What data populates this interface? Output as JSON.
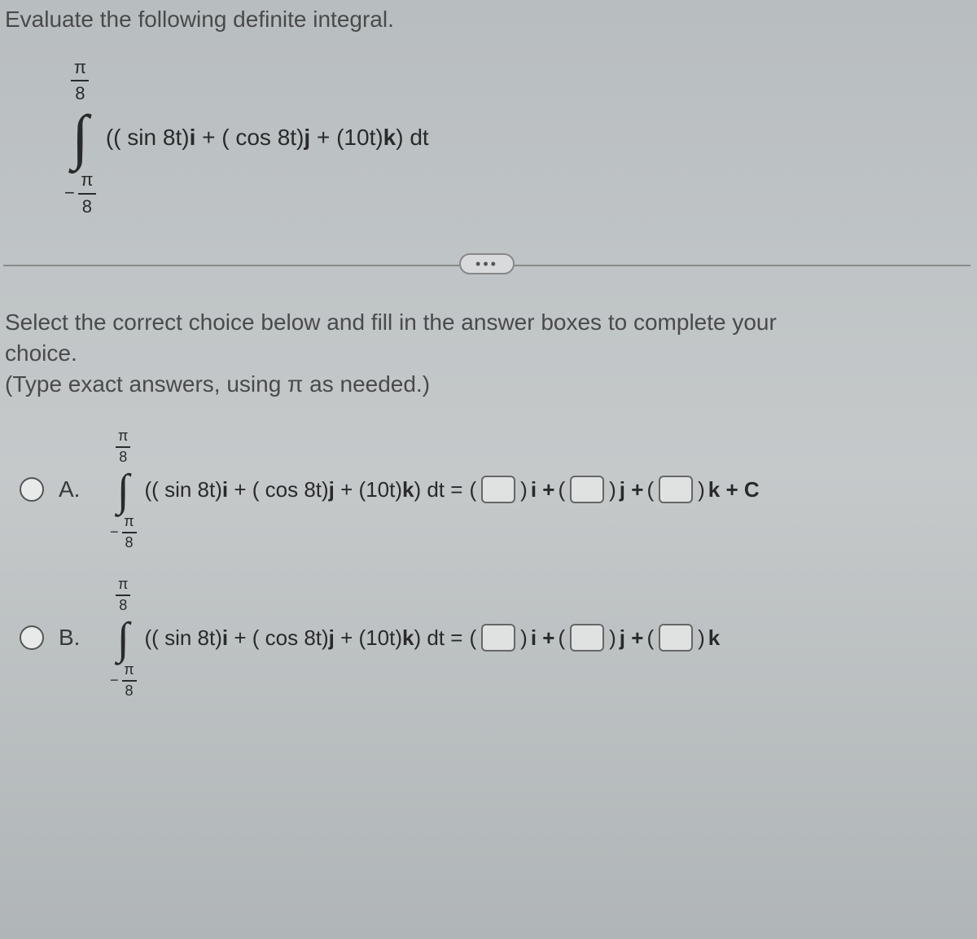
{
  "question": "Evaluate the following definite integral.",
  "integral": {
    "upper_num": "π",
    "upper_den": "8",
    "lower_minus": "−",
    "lower_num": "π",
    "lower_den": "8",
    "sym": "∫",
    "expr_open": "((",
    "sin": " sin ",
    "arg8t": "8t)",
    "i": "i",
    "plus1": " + (",
    "cos": " cos ",
    "j": "j",
    "plus2": " + (10t)",
    "k": "k",
    "close": ") dt"
  },
  "ellipsis": "•••",
  "instructions_line1": "Select the correct choice below and fill in the answer boxes to complete your",
  "instructions_line2": "choice.",
  "instructions_line3": "(Type exact answers, using π as needed.)",
  "choice_a": {
    "label": "A.",
    "eq": " =",
    "lp": "(",
    "rp": ")",
    "iplus": "i + ",
    "jplus": "j + ",
    "kplus": "k + C"
  },
  "choice_b": {
    "label": "B.",
    "eq": " =",
    "lp": "(",
    "rp": ")",
    "iplus": "i + ",
    "jplus": "j + ",
    "kend": "k"
  }
}
